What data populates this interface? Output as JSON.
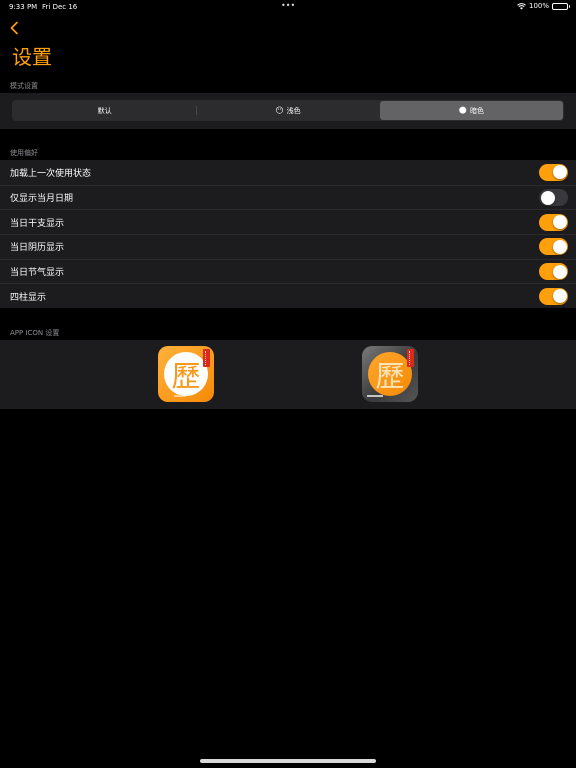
{
  "status_bar": {
    "time": "9:33 PM",
    "date": "Fri Dec 16",
    "dots": "•••",
    "battery_text": "100%"
  },
  "nav": {
    "back_icon": "chevron-left-icon",
    "title": "设置"
  },
  "mode_section": {
    "header": "模式设置",
    "segments": [
      {
        "label": "默认",
        "emoji": "",
        "selected": false
      },
      {
        "label": "浅色",
        "emoji": "😶",
        "selected": false
      },
      {
        "label": "暗色",
        "emoji": "🌑",
        "selected": true
      }
    ]
  },
  "prefs_section": {
    "header": "使用偏好",
    "rows": [
      {
        "label": "加载上一次使用状态",
        "on": true
      },
      {
        "label": "仅显示当月日期",
        "on": false
      },
      {
        "label": "当日干支显示",
        "on": true
      },
      {
        "label": "当日阴历显示",
        "on": true
      },
      {
        "label": "当日节气显示",
        "on": true
      },
      {
        "label": "四柱显示",
        "on": true
      }
    ]
  },
  "icon_section": {
    "header": "APP ICON 设置",
    "icons": [
      {
        "glyph": "歷",
        "variant": "light"
      },
      {
        "glyph": "歷",
        "variant": "dark"
      }
    ]
  },
  "colors": {
    "accent": "#ff9f0a",
    "background": "#000000",
    "panel": "#1c1c1e"
  }
}
